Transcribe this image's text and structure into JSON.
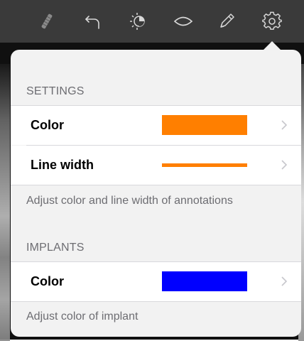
{
  "toolbar": {
    "icons": [
      "implant-icon",
      "undo-icon",
      "brightness-contrast-icon",
      "lens-icon",
      "pencil-icon",
      "gear-icon"
    ]
  },
  "settings": {
    "header": "SETTINGS",
    "rows": [
      {
        "label": "Color",
        "value_color": "#ff7f00"
      },
      {
        "label": "Line width",
        "value_color": "#ff7f00"
      }
    ],
    "footer": "Adjust color and line width of annotations"
  },
  "implants": {
    "header": "IMPLANTS",
    "rows": [
      {
        "label": "Color",
        "value_color": "#0000ff"
      }
    ],
    "footer": "Adjust color of implant"
  },
  "colors": {
    "toolbar_bg": "#3a3a3a",
    "popover_bg": "#f2f2f2",
    "annotation": "#ff7f00",
    "implant": "#0000ff"
  }
}
